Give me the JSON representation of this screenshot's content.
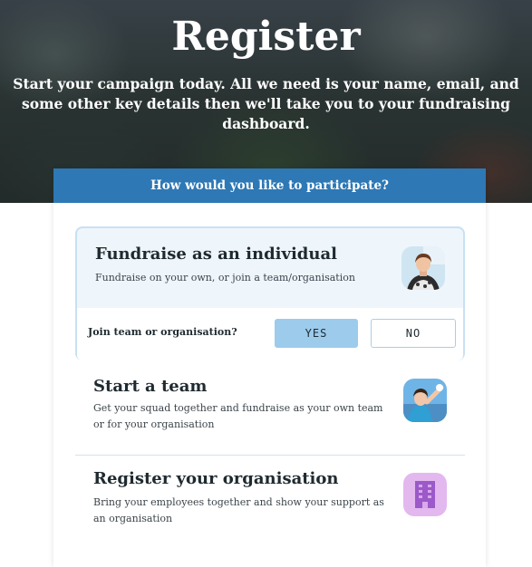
{
  "hero": {
    "title": "Register",
    "subtitle": "Start your campaign today. All we need is your name, email, and some other key details then we'll take you to your fundraising dashboard."
  },
  "card": {
    "header": "How would you like to participate?",
    "options": [
      {
        "title": "Fundraise as an individual",
        "description": "Fundraise on your own, or join a team/organisation",
        "icon": "person-avatar-icon",
        "selected": true
      },
      {
        "title": "Start a team",
        "description": "Get your squad together and fundraise as your own team or for your organisation",
        "icon": "team-avatar-icon",
        "selected": false
      },
      {
        "title": "Register your organisation",
        "description": "Bring your employees together and show your support as an organisation",
        "icon": "building-icon",
        "selected": false
      }
    ],
    "join": {
      "label": "Join team or organisation?",
      "yes_label": "YES",
      "no_label": "NO",
      "selected": "YES"
    }
  },
  "colors": {
    "header_blue": "#2e78b5",
    "selected_bg": "#eef6fc",
    "selected_border": "#c7e1f3",
    "yes_button": "#9ccbec",
    "org_icon_bg": "#e3b8ef",
    "org_icon_fg": "#9b59c9"
  }
}
